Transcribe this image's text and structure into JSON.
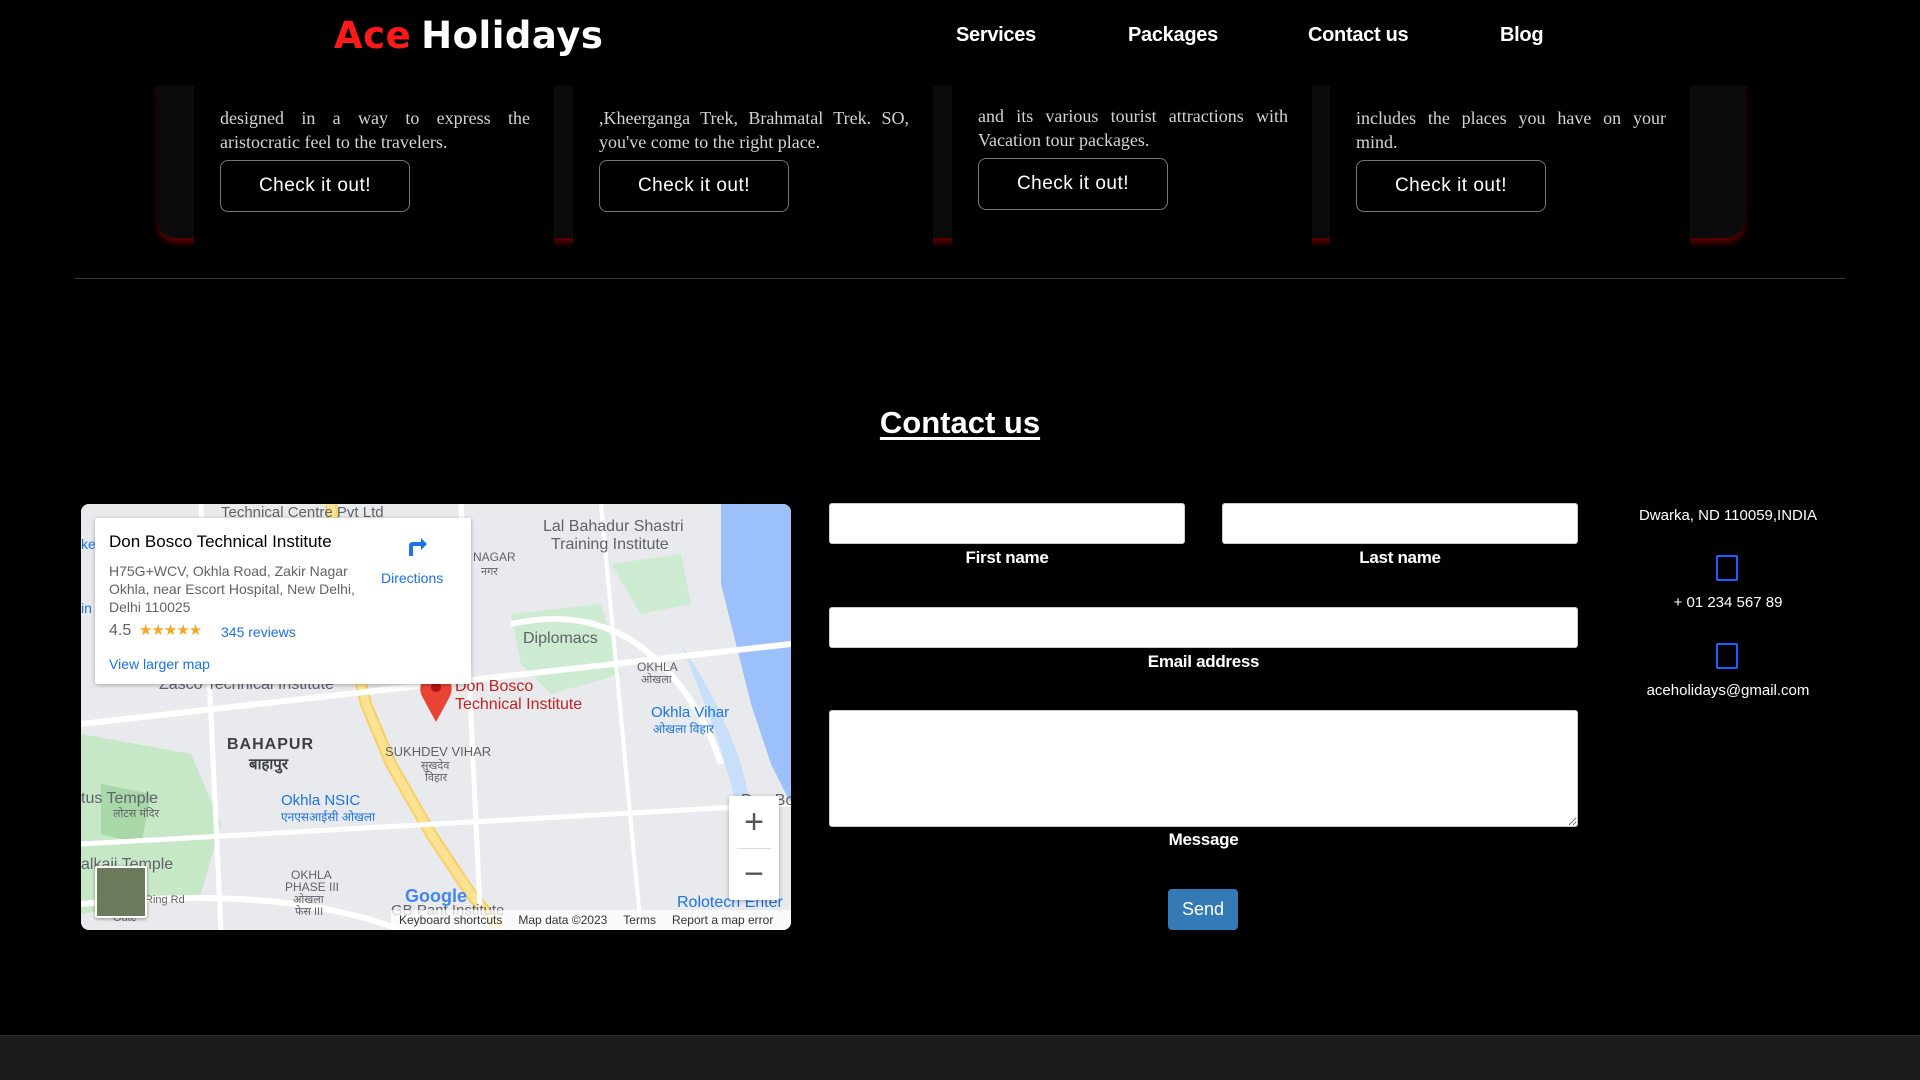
{
  "nav": {
    "brand_part1": "Ace",
    "brand_part2": "Holidays",
    "links": [
      "Services",
      "Packages",
      "Contact us",
      "Blog"
    ]
  },
  "cards": [
    {
      "text": "designed in a way to express the aristocratic feel to the travelers.",
      "button": "Check it out!"
    },
    {
      "text": ",Kheerganga Trek, Brahmatal Trek. SO, you've come to the right place.",
      "button": "Check it out!"
    },
    {
      "text": "and its various tourist attractions with Vacation tour packages.",
      "button": "Check it out!"
    },
    {
      "text": "includes the places you have on your mind.",
      "button": "Check it out!"
    }
  ],
  "contact": {
    "title": "Contact us",
    "map": {
      "place_name": "Don Bosco Technical Institute",
      "address": "H75G+WCV, Okhla Road, Zakir Nagar Okhla, near Escort Hospital, New Delhi, Delhi 110025",
      "rating": "4.5",
      "stars": "★★★★★",
      "reviews": "345 reviews",
      "larger_map": "View larger map",
      "directions": "Directions",
      "labels": {
        "technical_centre": "Technical Centre Pvt Ltd",
        "lal_bahadur": "Lal Bahadur Shastri",
        "training_institute": "Training Institute",
        "nagar": "NAGAR",
        "nagar_hi": "नगर",
        "diplomacs": "Diplomacs",
        "okhla": "OKHLA",
        "okhla_hi": "ओखला",
        "zasco": "Zasco Technical Institute",
        "pin_line1": "Don Bosco",
        "pin_line2": "Technical Institute",
        "okhla_vihar": "Okhla Vihar",
        "okhla_vihar_hi": "ओखला विहार",
        "bahapur": "BAHAPUR",
        "bahapur_hi": "बाहापुर",
        "sukhdev": "SUKHDEV VIHAR",
        "sukhdev_hi1": "सुखदेव",
        "sukhdev_hi2": "विहार",
        "lotus": "tus Temple",
        "lotus_hi": "लोटस मंदिर",
        "okhla_nsic": "Okhla NSIC",
        "okhla_nsic_hi": "एनएसआईसी ओखला",
        "kalkaji": "alkaji Temple",
        "okhla_phase": "OKHLA",
        "okhla_phase2": "PHASE III",
        "okhla_phase_hi1": "ओखला",
        "okhla_phase_hi2": "फेस III",
        "ring_rd": "Ring Rd",
        "outer": "Oute",
        "gb_pant": "GB Pant Institute",
        "rolotech": "Rolotech Enter",
        "ke": "ke",
        "in": "in",
        "google": "Google",
        "d_bo": "Don Bo"
      },
      "footer": [
        "Keyboard shortcuts",
        "Map data ©2023",
        "Terms",
        "Report a map error"
      ]
    },
    "form": {
      "first_name_label": "First name",
      "last_name_label": "Last name",
      "email_label": "Email address",
      "message_label": "Message",
      "send": "Send"
    },
    "info": {
      "address": "Dwarka, ND 110059,INDIA",
      "phone": "+ 01 234 567 89",
      "email": "aceholidays@gmail.com"
    }
  }
}
